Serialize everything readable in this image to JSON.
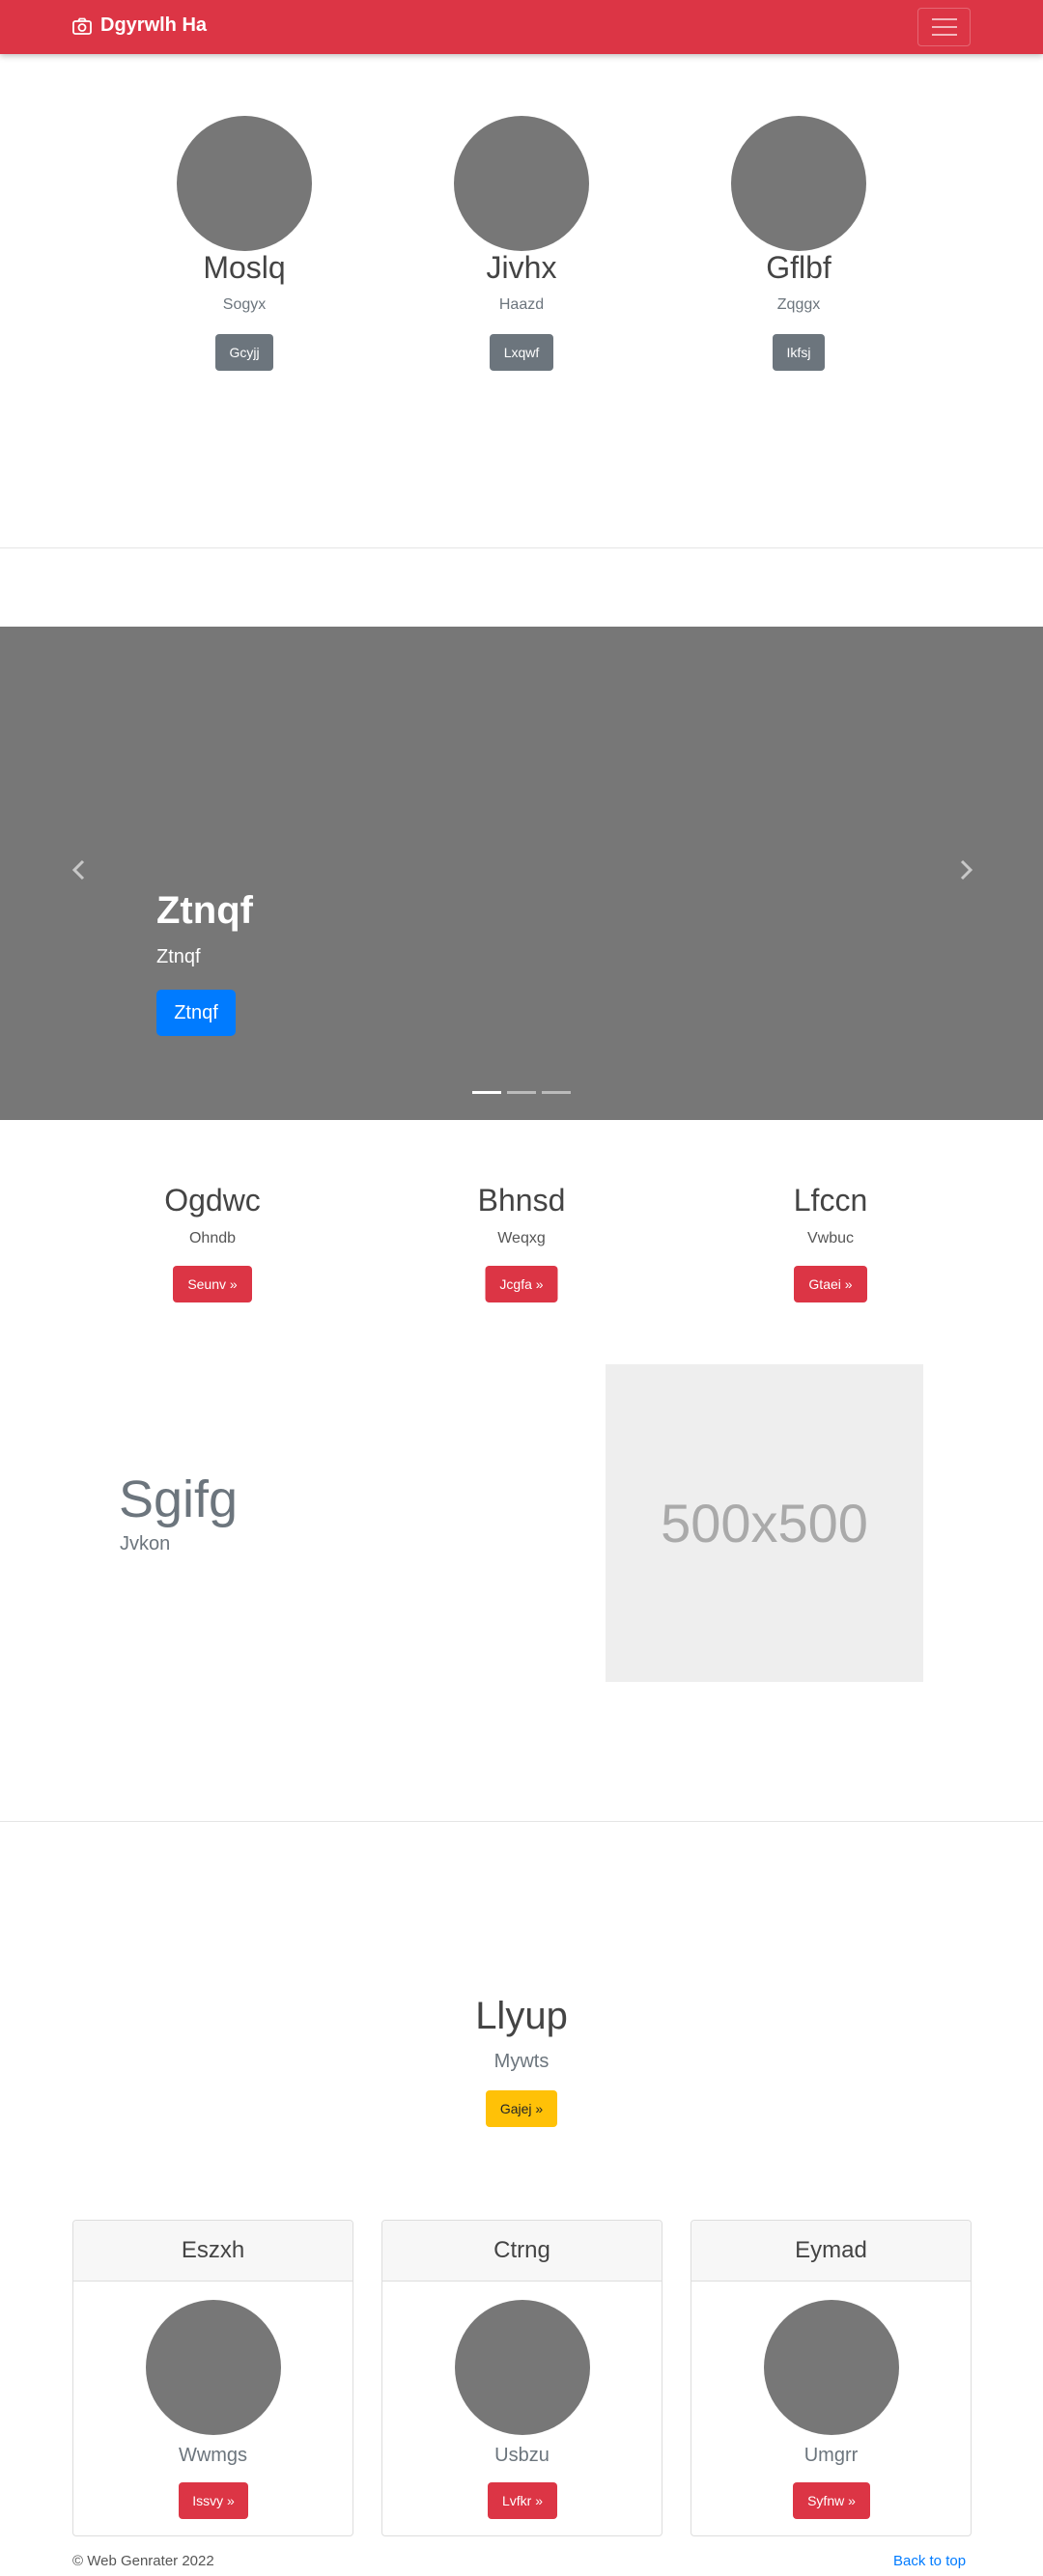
{
  "navbar": {
    "brand": "Dgyrwlh Ha",
    "icon": "camera-icon",
    "toggler_icon": "menu-icon",
    "color": "#dc3545"
  },
  "team": [
    {
      "name": "Moslq",
      "role": "Sogyx",
      "button": "Gcyjj"
    },
    {
      "name": "Jivhx",
      "role": "Haazd",
      "button": "Lxqwf"
    },
    {
      "name": "Gflbf",
      "role": "Zqggx",
      "button": "Ikfsj"
    }
  ],
  "carousel": {
    "title": "Ztnqf",
    "subtitle": "Ztnqf",
    "button": "Ztnqf",
    "slides": 3,
    "active_slide": 1
  },
  "features": [
    {
      "title": "Ogdwc",
      "text": "Ohndb",
      "button": "Seunv »"
    },
    {
      "title": "Bhnsd",
      "text": "Weqxg",
      "button": "Jcgfa »"
    },
    {
      "title": "Lfccn",
      "text": "Vwbuc",
      "button": "Gtaei »"
    }
  ],
  "feature_block": {
    "heading": "Sgifg",
    "lead": "Jvkon",
    "placeholder": "500x500"
  },
  "cta": {
    "heading": "Llyup",
    "lead": "Mywts",
    "button": "Gajej »"
  },
  "cards": [
    {
      "title": "Eszxh",
      "text": "Wwmgs",
      "button": "Issvy »"
    },
    {
      "title": "Ctrng",
      "text": "Usbzu",
      "button": "Lvfkr »"
    },
    {
      "title": "Eymad",
      "text": "Umgrr",
      "button": "Syfnw »"
    }
  ],
  "footer": {
    "copyright": "© Web Genrater 2022",
    "back_to_top": "Back to top"
  }
}
